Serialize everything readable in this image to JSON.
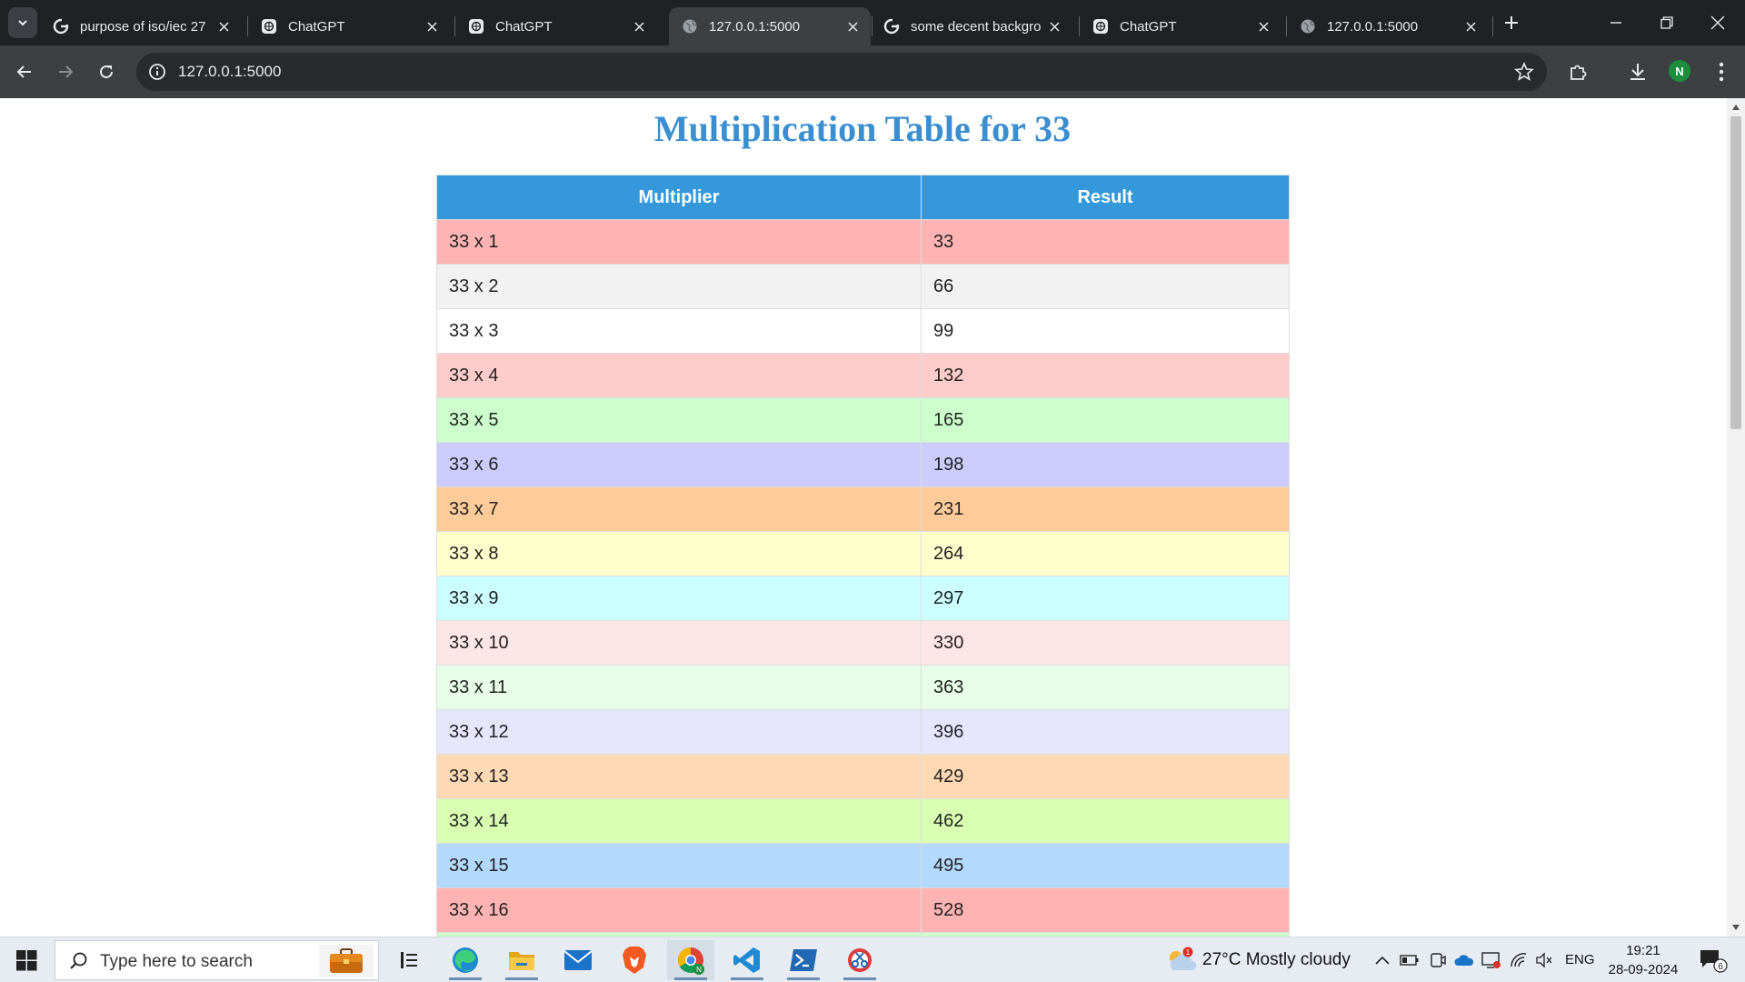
{
  "browser": {
    "tabs": [
      {
        "title": "purpose of iso/iec 27",
        "favicon": "google-icon",
        "active": false
      },
      {
        "title": "ChatGPT",
        "favicon": "chatgpt-icon",
        "active": false
      },
      {
        "title": "ChatGPT",
        "favicon": "chatgpt-icon",
        "active": false
      },
      {
        "title": "127.0.0.1:5000",
        "favicon": "globe-icon",
        "active": true
      },
      {
        "title": "some decent backgro",
        "favicon": "google-icon",
        "active": false
      },
      {
        "title": "ChatGPT",
        "favicon": "chatgpt-icon",
        "active": false
      },
      {
        "title": "127.0.0.1:5000",
        "favicon": "globe-icon",
        "active": false
      }
    ],
    "address": "127.0.0.1:5000",
    "profile_initial": "N"
  },
  "page": {
    "title": "Multiplication Table for 33",
    "table": {
      "headers": [
        "Multiplier",
        "Result"
      ],
      "rows": [
        {
          "multiplier": "33 x 1",
          "result": "33",
          "color": "#ffb3b3"
        },
        {
          "multiplier": "33 x 2",
          "result": "66",
          "color": "#f2f2f2"
        },
        {
          "multiplier": "33 x 3",
          "result": "99",
          "color": "#ffffff"
        },
        {
          "multiplier": "33 x 4",
          "result": "132",
          "color": "#ffcccc"
        },
        {
          "multiplier": "33 x 5",
          "result": "165",
          "color": "#ccffcc"
        },
        {
          "multiplier": "33 x 6",
          "result": "198",
          "color": "#ccccff"
        },
        {
          "multiplier": "33 x 7",
          "result": "231",
          "color": "#ffcc99"
        },
        {
          "multiplier": "33 x 8",
          "result": "264",
          "color": "#ffffcc"
        },
        {
          "multiplier": "33 x 9",
          "result": "297",
          "color": "#ccffff"
        },
        {
          "multiplier": "33 x 10",
          "result": "330",
          "color": "#ffe6e6"
        },
        {
          "multiplier": "33 x 11",
          "result": "363",
          "color": "#e6ffe6"
        },
        {
          "multiplier": "33 x 12",
          "result": "396",
          "color": "#e6e6ff"
        },
        {
          "multiplier": "33 x 13",
          "result": "429",
          "color": "#ffd9b3"
        },
        {
          "multiplier": "33 x 14",
          "result": "462",
          "color": "#d9ffb3"
        },
        {
          "multiplier": "33 x 15",
          "result": "495",
          "color": "#b3d9ff"
        },
        {
          "multiplier": "33 x 16",
          "result": "528",
          "color": "#ffb3b3"
        },
        {
          "multiplier": "",
          "result": "",
          "color": "#ccffcc"
        }
      ]
    }
  },
  "taskbar": {
    "search_placeholder": "Type here to search",
    "weather": "27°C  Mostly cloudy",
    "weather_badge": "1",
    "language": "ENG",
    "time": "19:21",
    "date": "28-09-2024",
    "notification_count": "6"
  }
}
